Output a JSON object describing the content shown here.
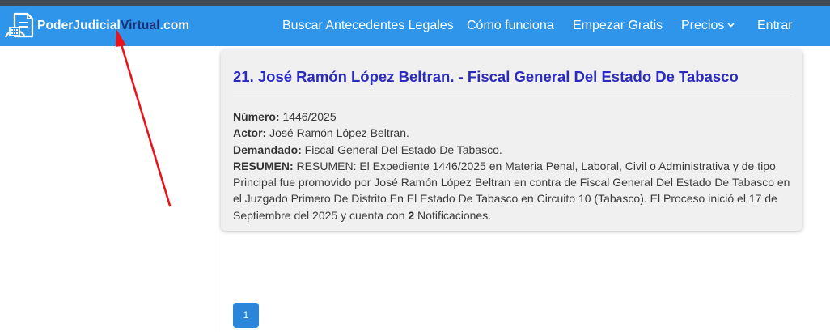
{
  "navbar": {
    "logo": {
      "part_white": "PoderJudicial",
      "part_dark": "Virtual",
      "part_end": ".com"
    },
    "items": [
      {
        "label": "Buscar Antecedentes Legales"
      },
      {
        "label": "Cómo funciona"
      },
      {
        "label": "Empezar Gratis"
      },
      {
        "label": "Precios"
      },
      {
        "label": "Entrar"
      }
    ]
  },
  "result": {
    "title": "21. José Ramón López Beltran. - Fiscal General Del Estado De Tabasco",
    "numero_label": "Número:",
    "numero_value": " 1446/2025",
    "actor_label": "Actor:",
    "actor_value": " José Ramón López Beltran.",
    "demandado_label": "Demandado:",
    "demandado_value": " Fiscal General Del Estado De Tabasco.",
    "resumen_label": "RESUMEN:",
    "resumen_text": " RESUMEN: El Expediente 1446/2025 en Materia Penal, Laboral, Civil o Administrativa y de tipo Principal fue promovido por José Ramón López Beltran en contra de Fiscal General Del Estado De Tabasco en el Juzgado Primero De Distrito En El Estado De Tabasco en Circuito 10 (Tabasco). El Proceso inició el 17 de Septiembre del 2025 y cuenta con ",
    "notificaciones_count": "2",
    "resumen_end": " Notificaciones."
  },
  "pagination": {
    "current": "1"
  },
  "colors": {
    "navbar": "#2f95ea",
    "title": "#2b2bbf",
    "page_button": "#2a86d8",
    "annotation_arrow": "#e8141b"
  }
}
